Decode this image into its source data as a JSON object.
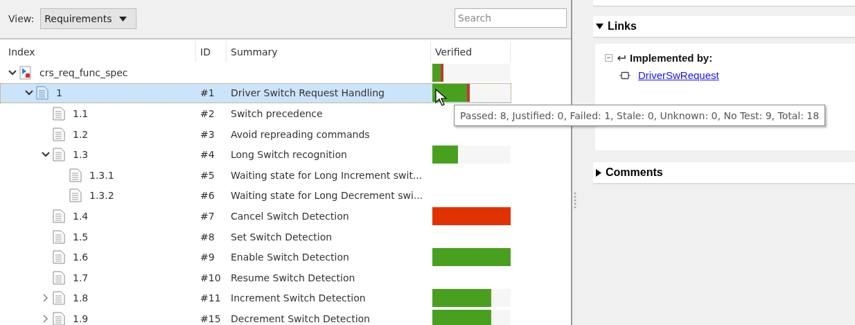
{
  "toolbar": {
    "view_label": "View:",
    "view_value": "Requirements",
    "search": {
      "placeholder": "Search"
    }
  },
  "table": {
    "columns": [
      "Index",
      "ID",
      "Summary",
      "Verified"
    ],
    "rows": [
      {
        "index": "crs_req_func_spec",
        "kind": "set",
        "id": "",
        "summary": "",
        "expanded": true,
        "selected": false,
        "verified": {
          "kind": "passed_failed",
          "level": 0.11
        },
        "children": [
          {
            "index": "1",
            "kind": "requirement",
            "id": "#1",
            "summary": "Driver Switch Request Handling",
            "expanded": true,
            "selected": true,
            "verified": {
              "kind": "passed_failed",
              "level": 0.44
            },
            "children": [
              {
                "index": "1.1",
                "kind": "requirement",
                "id": "#2",
                "summary": "Switch precedence",
                "selected": false
              },
              {
                "index": "1.2",
                "kind": "requirement",
                "id": "#3",
                "summary": "Avoid repreading commands",
                "selected": false
              },
              {
                "index": "1.3",
                "kind": "requirement",
                "id": "#4",
                "summary": "Long Switch recognition",
                "expanded": true,
                "selected": false,
                "verified": {
                  "kind": "passed",
                  "level": 0.33
                },
                "children": [
                  {
                    "index": "1.3.1",
                    "kind": "requirement",
                    "id": "#5",
                    "summary": "Waiting state for Long Increment swit...",
                    "selected": false
                  },
                  {
                    "index": "1.3.2",
                    "kind": "requirement",
                    "id": "#6",
                    "summary": "Waiting state for Long Decrement swi...",
                    "selected": false
                  }
                ]
              },
              {
                "index": "1.4",
                "kind": "requirement",
                "id": "#7",
                "summary": "Cancel Switch Detection",
                "selected": false,
                "verified": {
                  "kind": "failed",
                  "level": 1
                }
              },
              {
                "index": "1.5",
                "kind": "requirement",
                "id": "#8",
                "summary": "Set Switch Detection",
                "selected": false
              },
              {
                "index": "1.6",
                "kind": "requirement",
                "id": "#9",
                "summary": "Enable Switch Detection",
                "selected": false,
                "verified": {
                  "kind": "passed",
                  "level": 1
                }
              },
              {
                "index": "1.7",
                "kind": "requirement",
                "id": "#10",
                "summary": "Resume Switch Detection",
                "selected": false
              },
              {
                "index": "1.8",
                "kind": "requirement",
                "id": "#11",
                "summary": "Increment Switch Detection",
                "expanded": false,
                "selected": false,
                "verified": {
                  "kind": "passed",
                  "level": 0.75
                }
              },
              {
                "index": "1.9",
                "kind": "requirement",
                "id": "#15",
                "summary": "Decrement Switch Detection",
                "expanded": false,
                "selected": false,
                "verified": {
                  "kind": "passed",
                  "level": 0.75
                }
              }
            ]
          }
        ]
      }
    ]
  },
  "tooltip": "Passed: 8, Justified: 0, Failed: 1, Stale: 0, Unknown: 0, No Test: 9, Total: 18",
  "details": {
    "sections": [
      {
        "title": "Links",
        "expanded": true,
        "groups": [
          {
            "label": "Implemented by:",
            "expanded": true,
            "links": [
              "DriverSwRequest"
            ]
          }
        ]
      },
      {
        "title": "Comments",
        "expanded": false
      }
    ]
  }
}
